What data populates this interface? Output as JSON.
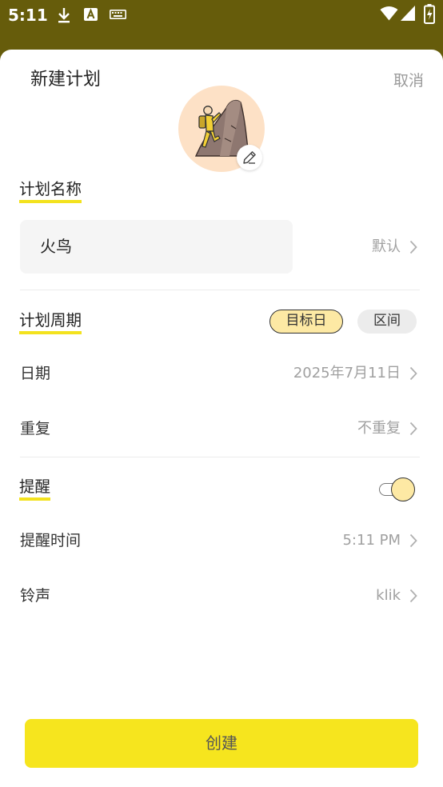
{
  "status_bar": {
    "time": "5:11",
    "icons": [
      "download-icon",
      "font-a-icon",
      "keyboard-icon",
      "wifi-icon",
      "signal-icon",
      "battery-icon"
    ]
  },
  "header": {
    "title": "新建计划",
    "cancel_label": "取消"
  },
  "avatar": {
    "icon": "climber-illustration",
    "edit_icon": "pencil-icon"
  },
  "plan_name": {
    "label": "计划名称",
    "value": "火鸟",
    "default_label": "默认"
  },
  "period": {
    "label": "计划周期",
    "segments": [
      "目标日",
      "区间"
    ],
    "selected_index": 0
  },
  "date": {
    "label": "日期",
    "value": "2025年7月11日"
  },
  "repeat": {
    "label": "重复",
    "value": "不重复"
  },
  "reminder": {
    "label": "提醒",
    "enabled": true
  },
  "reminder_time": {
    "label": "提醒时间",
    "value": "5:11 PM"
  },
  "ringtone": {
    "label": "铃声",
    "value": "klik"
  },
  "create_button": {
    "label": "创建"
  },
  "colors": {
    "status_bar": "#665c0b",
    "accent_yellow": "#f6e51e",
    "segment_selected": "#fde9a4",
    "avatar_bg": "#fde1c6",
    "secondary_text": "#a0a0a0"
  }
}
